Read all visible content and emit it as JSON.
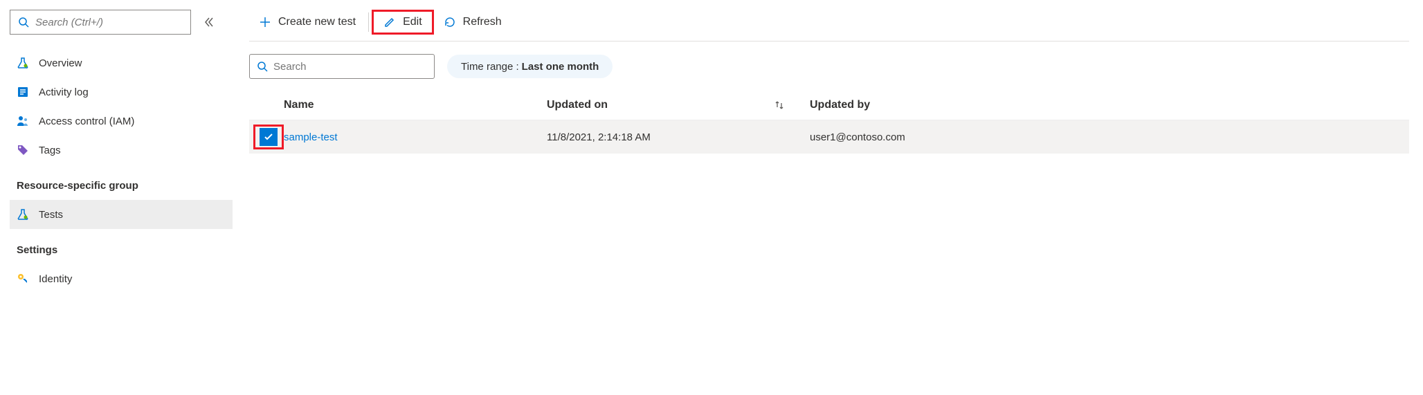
{
  "sidebar": {
    "search_placeholder": "Search (Ctrl+/)",
    "items": [
      {
        "label": "Overview",
        "icon": "flask"
      },
      {
        "label": "Activity log",
        "icon": "log"
      },
      {
        "label": "Access control (IAM)",
        "icon": "iam"
      },
      {
        "label": "Tags",
        "icon": "tag"
      }
    ],
    "group1_label": "Resource-specific group",
    "group1_items": [
      {
        "label": "Tests",
        "icon": "flask",
        "active": true
      }
    ],
    "group2_label": "Settings",
    "group2_items": [
      {
        "label": "Identity",
        "icon": "key"
      }
    ]
  },
  "toolbar": {
    "create_label": "Create new test",
    "edit_label": "Edit",
    "refresh_label": "Refresh"
  },
  "filter": {
    "search_placeholder": "Search",
    "time_label": "Time range :",
    "time_value": "Last one month"
  },
  "table": {
    "headers": {
      "name": "Name",
      "updated_on": "Updated on",
      "updated_by": "Updated by"
    },
    "rows": [
      {
        "checked": true,
        "name": "sample-test",
        "updated_on": "11/8/2021, 2:14:18 AM",
        "updated_by": "user1@contoso.com"
      }
    ]
  }
}
